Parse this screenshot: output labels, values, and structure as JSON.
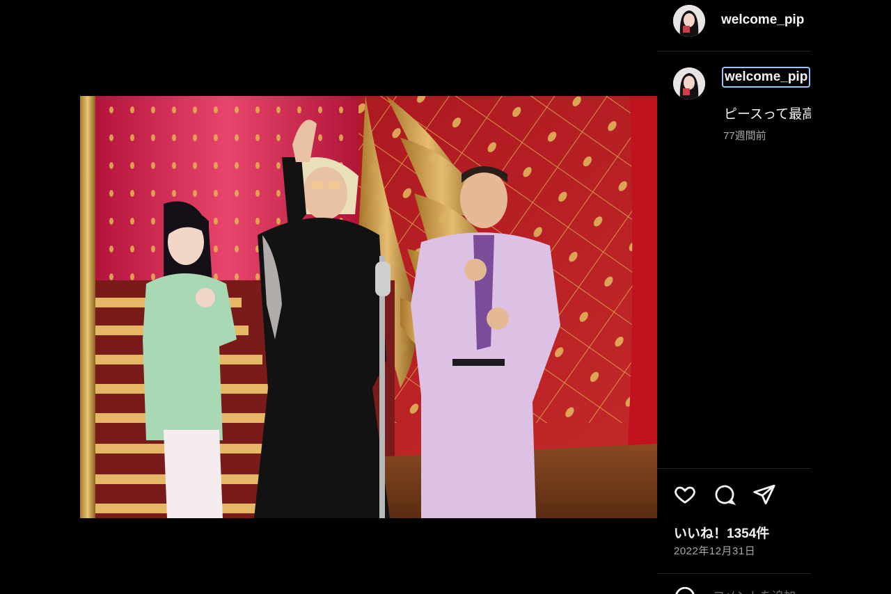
{
  "post": {
    "username": "welcome_pip",
    "caption": "ピースって最高",
    "time_ago": "77週間前",
    "likes": "いいね！1354件",
    "date": "2022年12月31日",
    "comment_placeholder": "コメントを追加"
  },
  "icons": {
    "like": "heart-icon",
    "comment": "comment-icon",
    "share": "send-icon",
    "emoji": "emoji-icon"
  },
  "colors": {
    "background": "#000000",
    "text": "#f5f5f5",
    "muted": "#a8a8a8",
    "divider": "#262626",
    "focus_outline": "#9ec5ff"
  }
}
